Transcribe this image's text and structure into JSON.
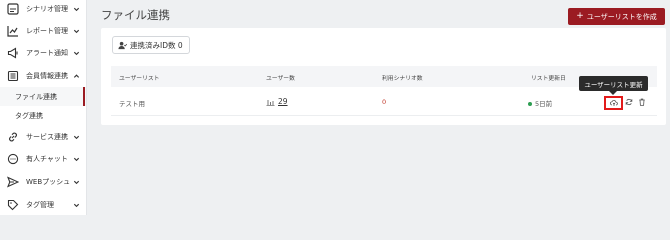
{
  "sidebar": {
    "items": [
      {
        "label": "シナリオ管理",
        "icon": "scenario-icon"
      },
      {
        "label": "レポート管理",
        "icon": "chart-line-icon"
      },
      {
        "label": "アラート通知",
        "icon": "megaphone-icon"
      },
      {
        "label": "会員情報連携",
        "icon": "member-list-icon"
      },
      {
        "label": "サービス連携",
        "icon": "link-icon"
      },
      {
        "label": "有人チャット",
        "icon": "chat-bubble-icon"
      },
      {
        "label": "WEBプッシュ",
        "icon": "send-icon"
      },
      {
        "label": "タグ管理",
        "icon": "tag-icon"
      }
    ],
    "subitems": [
      {
        "label": "ファイル連携",
        "active": true
      },
      {
        "label": "タグ連携",
        "active": false
      }
    ]
  },
  "header": {
    "title": "ファイル連携",
    "create_button": "ユーザーリストを作成"
  },
  "linked_ids_label": "連携済みID数 0",
  "table": {
    "columns": [
      "ユーザーリスト",
      "ユーザー数",
      "利用シナリオ数",
      "リスト更新日"
    ],
    "rows": [
      {
        "list_name": "テスト用",
        "user_count": "29",
        "scenario_count": "0",
        "updated": "5日前"
      }
    ]
  },
  "tooltip": "ユーザーリスト更新",
  "colors": {
    "accent": "#9b1b22",
    "status_green": "#2e9e52",
    "highlight": "#e21b1b"
  }
}
